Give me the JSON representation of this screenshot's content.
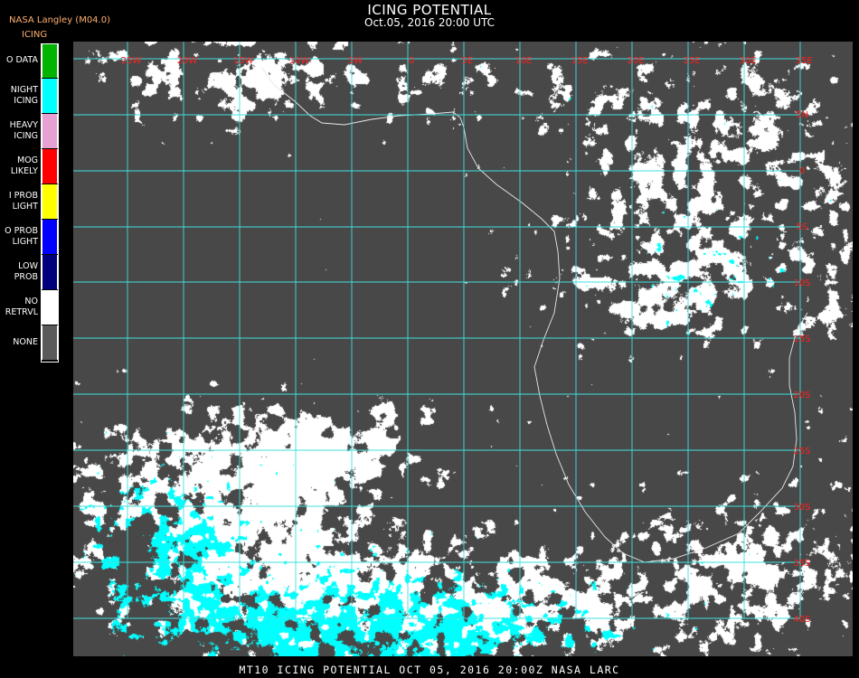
{
  "header": {
    "producer": "NASA Langley (M04.0)",
    "legend_title": "ICING",
    "title": "ICING POTENTIAL",
    "subtitle": "Oct.05, 2016 20:00 UTC"
  },
  "legend": [
    {
      "label": "O DATA",
      "color": "#00b400"
    },
    {
      "label": "NIGHT\nICING",
      "color": "#00ffff"
    },
    {
      "label": "HEAVY\nICING",
      "color": "#e6a0d2"
    },
    {
      "label": "MOG\nLIKELY",
      "color": "#ff0000"
    },
    {
      "label": "I PROB\nLIGHT",
      "color": "#ffff00"
    },
    {
      "label": "O PROB\nLIGHT",
      "color": "#0000ff"
    },
    {
      "label": "LOW\nPROB",
      "color": "#00007d"
    },
    {
      "label": "NO\nRETRVL",
      "color": "#ffffff"
    },
    {
      "label": "NONE",
      "color": "#5a5a5a"
    }
  ],
  "map": {
    "background_color": "#484848",
    "grid_color": "#40e0e0",
    "label_color": "#ff2020",
    "longitude_labels": [
      "25W",
      "20W",
      "15W",
      "10W",
      "5W",
      "0",
      "5E",
      "10E",
      "15E",
      "20E",
      "25E",
      "30E",
      "35E"
    ],
    "latitude_labels": [
      "5N",
      "0",
      "5S",
      "10S",
      "15S",
      "20S",
      "25S",
      "30S",
      "35S",
      "40S"
    ]
  },
  "footer": {
    "text": "MT10  ICING POTENTIAL   OCT 05, 2016 20:00Z   NASA LARC"
  }
}
